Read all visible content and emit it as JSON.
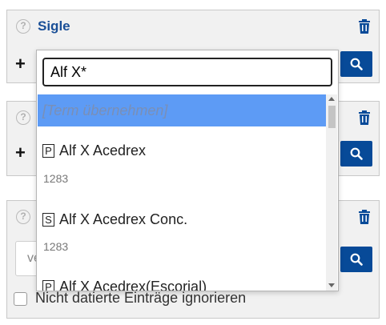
{
  "panel1": {
    "title": "Sigle"
  },
  "dropdown": {
    "input_value": "Alf X*",
    "first_option": "[Term übernehmen]",
    "options": [
      {
        "badge": "P",
        "label": "Alf X Acedrex",
        "count": "1283"
      },
      {
        "badge": "S",
        "label": "Alf X Acedrex Conc.",
        "count": "1283"
      },
      {
        "badge": "P",
        "label": "Alf X Acedrex(Escorial)",
        "count": ""
      }
    ]
  },
  "panel3": {
    "input_partial": "ve"
  },
  "checkbox": {
    "label": "Nicht datierte Einträge ignorieren"
  },
  "icons": {
    "help": "help-icon",
    "trash": "trash-icon",
    "search": "search-icon",
    "plus": "plus-icon"
  },
  "colors": {
    "accent": "#074a98",
    "title": "#1a4f97",
    "highlight": "#5d9bf5"
  }
}
